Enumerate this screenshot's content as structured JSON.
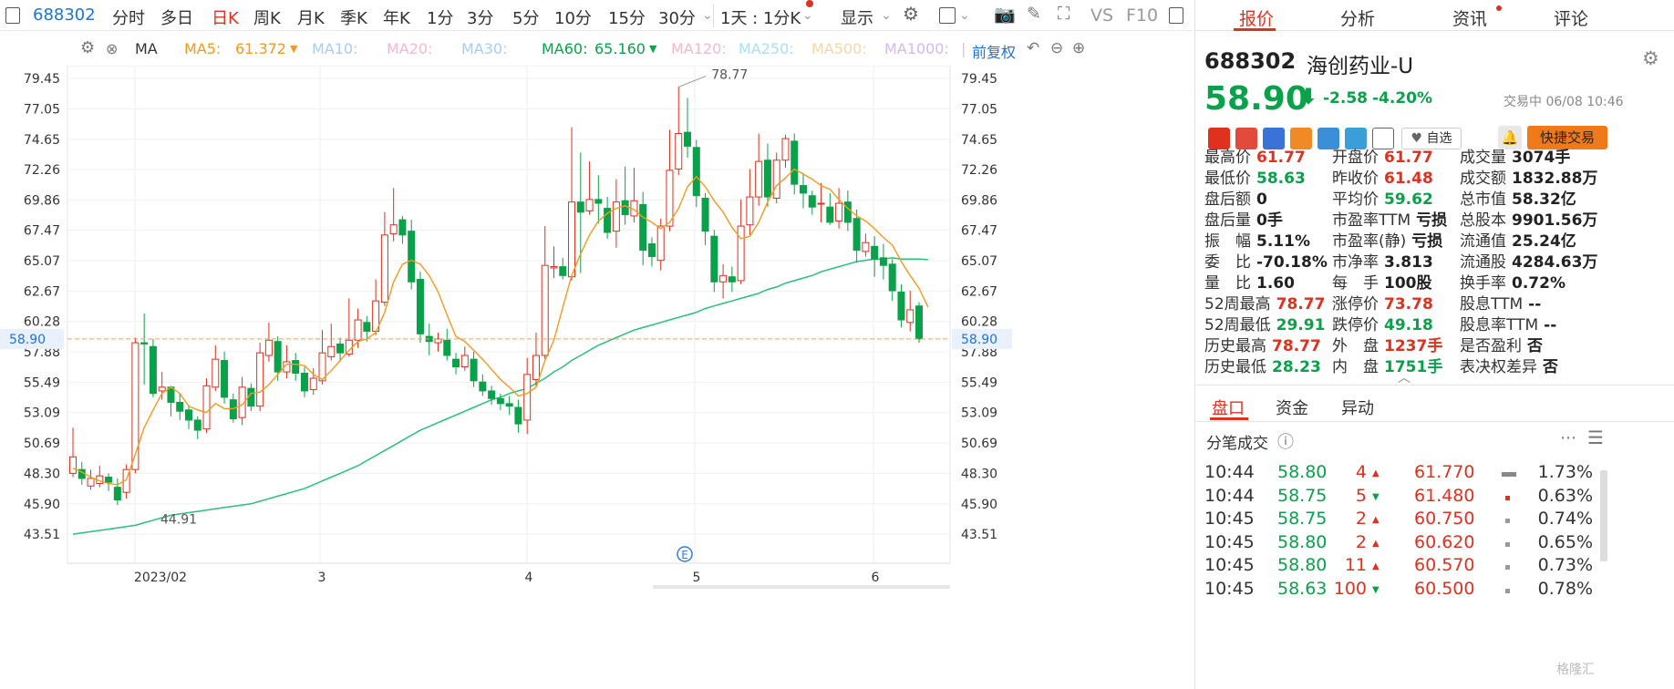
{
  "toolbar": {
    "code": "688302",
    "periods": [
      "分时",
      "多日",
      "日K",
      "周K",
      "月K",
      "季K",
      "年K",
      "1分",
      "3分",
      "5分",
      "10分",
      "15分",
      "30分"
    ],
    "active_period": "日K",
    "range_select": "1天 : 1分K",
    "display_label": "显示",
    "vs_label": "VS",
    "f10_label": "F10"
  },
  "indicators": {
    "type_label": "MA",
    "ma5_label": "MA5:",
    "ma5_value": "61.372",
    "ma10_label": "MA10:",
    "ma20_label": "MA20:",
    "ma30_label": "MA30:",
    "ma60_label": "MA60:",
    "ma60_value": "65.160",
    "ma120_label": "MA120:",
    "ma250_label": "MA250:",
    "ma500_label": "MA500:",
    "ma1000_label": "MA1000:",
    "adjust_label": "前复权"
  },
  "chart_data": {
    "type": "candlestick",
    "y_ticks": [
      "79.45",
      "77.05",
      "74.65",
      "72.26",
      "69.86",
      "67.47",
      "65.07",
      "62.67",
      "60.28",
      "57.88",
      "55.49",
      "53.09",
      "50.69",
      "48.30",
      "45.90",
      "43.51"
    ],
    "ylim": [
      43.51,
      79.45
    ],
    "x_labels": [
      "2023/02",
      "3",
      "4",
      "5",
      "6"
    ],
    "last_price": "58.90",
    "annotations": {
      "high": "78.77",
      "low": "44.91"
    },
    "event_marker": "E",
    "candles": [
      [
        48.3,
        49.6,
        51.9,
        48.0
      ],
      [
        48.6,
        47.9,
        49.2,
        47.4
      ],
      [
        47.3,
        47.9,
        48.6,
        47.0
      ],
      [
        47.5,
        48.1,
        48.9,
        47.2
      ],
      [
        48.0,
        47.6,
        48.3,
        46.9
      ],
      [
        47.2,
        46.2,
        47.9,
        45.8
      ],
      [
        46.8,
        48.6,
        49.0,
        46.3
      ],
      [
        48.6,
        58.6,
        59.0,
        48.3
      ],
      [
        58.6,
        58.5,
        60.9,
        55.3
      ],
      [
        58.3,
        54.6,
        58.9,
        54.3
      ],
      [
        54.8,
        55.1,
        56.3,
        54.1
      ],
      [
        55.1,
        53.9,
        55.2,
        52.8
      ],
      [
        53.9,
        53.2,
        54.6,
        52.5
      ],
      [
        53.3,
        52.5,
        53.7,
        51.8
      ],
      [
        52.5,
        51.7,
        52.8,
        51.0
      ],
      [
        51.8,
        55.2,
        55.8,
        51.5
      ],
      [
        55.1,
        57.3,
        58.4,
        54.8
      ],
      [
        57.2,
        54.3,
        57.9,
        53.8
      ],
      [
        54.1,
        52.6,
        54.6,
        52.3
      ],
      [
        52.7,
        55.1,
        55.9,
        52.1
      ],
      [
        55.0,
        53.6,
        55.4,
        53.2
      ],
      [
        53.6,
        57.8,
        58.6,
        53.2
      ],
      [
        57.6,
        58.8,
        60.2,
        57.1
      ],
      [
        58.7,
        56.3,
        59.1,
        55.6
      ],
      [
        56.3,
        57.1,
        58.4,
        55.8
      ],
      [
        57.2,
        56.2,
        57.8,
        55.6
      ],
      [
        56.2,
        54.8,
        56.7,
        54.3
      ],
      [
        54.9,
        55.8,
        56.6,
        54.5
      ],
      [
        55.6,
        57.8,
        59.6,
        55.3
      ],
      [
        57.5,
        58.3,
        60.1,
        57.2
      ],
      [
        58.5,
        57.8,
        59.0,
        57.1
      ],
      [
        57.7,
        58.8,
        62.1,
        57.5
      ],
      [
        58.8,
        60.4,
        61.3,
        58.2
      ],
      [
        60.2,
        59.5,
        60.7,
        58.7
      ],
      [
        59.5,
        61.9,
        63.6,
        59.2
      ],
      [
        61.8,
        67.1,
        68.9,
        61.5
      ],
      [
        67.2,
        67.9,
        70.8,
        66.6
      ],
      [
        68.3,
        67.1,
        68.6,
        66.4
      ],
      [
        67.4,
        63.4,
        68.3,
        62.8
      ],
      [
        63.6,
        59.3,
        64.2,
        58.6
      ],
      [
        59.1,
        58.7,
        60.1,
        57.6
      ],
      [
        58.6,
        58.9,
        59.4,
        57.9
      ],
      [
        58.8,
        57.6,
        59.7,
        57.2
      ],
      [
        57.3,
        56.7,
        57.8,
        56.1
      ],
      [
        56.7,
        57.6,
        58.3,
        56.4
      ],
      [
        57.3,
        55.6,
        57.9,
        55.1
      ],
      [
        55.5,
        54.8,
        56.1,
        54.4
      ],
      [
        54.8,
        54.2,
        55.2,
        53.7
      ],
      [
        54.2,
        53.8,
        54.6,
        53.3
      ],
      [
        53.8,
        53.6,
        54.4,
        52.9
      ],
      [
        53.5,
        52.2,
        54.1,
        51.5
      ],
      [
        52.5,
        56.1,
        57.4,
        51.4
      ],
      [
        55.7,
        57.6,
        59.4,
        55.1
      ],
      [
        57.6,
        64.7,
        67.8,
        57.3
      ],
      [
        64.5,
        64.6,
        66.2,
        63.7
      ],
      [
        64.6,
        63.9,
        65.3,
        63.6
      ],
      [
        63.8,
        69.7,
        75.6,
        63.5
      ],
      [
        69.7,
        68.9,
        73.6,
        64.1
      ],
      [
        69.0,
        69.9,
        72.9,
        68.7
      ],
      [
        69.9,
        69.6,
        71.8,
        68.0
      ],
      [
        69.2,
        67.3,
        70.1,
        66.8
      ],
      [
        67.4,
        69.7,
        71.5,
        66.1
      ],
      [
        69.8,
        68.7,
        72.5,
        67.9
      ],
      [
        68.6,
        69.8,
        72.4,
        68.1
      ],
      [
        69.5,
        65.9,
        70.5,
        64.7
      ],
      [
        66.4,
        65.4,
        66.9,
        64.6
      ],
      [
        65.1,
        67.8,
        68.4,
        64.3
      ],
      [
        67.8,
        72.2,
        75.4,
        67.4
      ],
      [
        72.3,
        75.1,
        78.8,
        71.8
      ],
      [
        75.2,
        74.1,
        77.9,
        73.2
      ],
      [
        74.0,
        70.2,
        74.6,
        69.3
      ],
      [
        70.0,
        67.4,
        70.4,
        66.3
      ],
      [
        67.0,
        63.4,
        67.5,
        62.6
      ],
      [
        63.4,
        63.9,
        64.8,
        62.1
      ],
      [
        63.8,
        63.4,
        64.6,
        62.6
      ],
      [
        63.5,
        67.8,
        69.9,
        63.2
      ],
      [
        67.9,
        70.1,
        72.3,
        67.1
      ],
      [
        70.1,
        72.9,
        75.1,
        69.4
      ],
      [
        73.0,
        70.1,
        74.3,
        69.3
      ],
      [
        70.0,
        73.0,
        73.6,
        69.6
      ],
      [
        73.0,
        74.7,
        75.0,
        72.4
      ],
      [
        74.5,
        71.1,
        75.1,
        70.3
      ],
      [
        71.0,
        70.4,
        72.0,
        69.2
      ],
      [
        70.2,
        69.3,
        70.6,
        68.7
      ],
      [
        69.6,
        69.6,
        71.2,
        68.1
      ],
      [
        69.3,
        68.1,
        70.4,
        67.9
      ],
      [
        68.2,
        69.6,
        70.8,
        67.6
      ],
      [
        69.7,
        68.1,
        70.6,
        67.4
      ],
      [
        68.4,
        65.9,
        69.1,
        64.9
      ],
      [
        65.8,
        66.5,
        67.2,
        65.4
      ],
      [
        66.2,
        65.2,
        67.0,
        63.8
      ],
      [
        65.3,
        64.7,
        66.4,
        63.6
      ],
      [
        64.8,
        62.7,
        65.2,
        61.9
      ],
      [
        62.6,
        60.4,
        63.2,
        59.8
      ],
      [
        60.2,
        61.2,
        62.7,
        59.5
      ],
      [
        61.5,
        58.9,
        61.8,
        58.6
      ]
    ],
    "ma5": [
      48.7,
      48.4,
      48.0,
      47.7,
      47.5,
      47.4,
      47.8,
      49.8,
      51.9,
      53.3,
      54.6,
      55.1,
      54.6,
      53.6,
      53.3,
      53.1,
      53.8,
      53.4,
      53.4,
      53.7,
      54.6,
      54.7,
      55.3,
      56.1,
      56.9,
      56.9,
      56.8,
      56.1,
      55.7,
      56.4,
      57.2,
      58.0,
      58.7,
      58.9,
      59.4,
      61.0,
      63.4,
      64.8,
      65.1,
      64.8,
      63.9,
      62.6,
      60.8,
      59.1,
      58.7,
      58.0,
      57.3,
      56.5,
      55.7,
      55.1,
      54.4,
      54.6,
      55.1,
      57.2,
      58.8,
      61.4,
      63.9,
      65.6,
      67.1,
      68.2,
      68.8,
      69.2,
      69.4,
      69.1,
      68.5,
      68.1,
      67.6,
      68.1,
      69.2,
      70.9,
      71.7,
      70.9,
      69.8,
      68.9,
      67.7,
      66.8,
      67.0,
      68.1,
      69.7,
      71.0,
      71.6,
      72.3,
      71.9,
      71.5,
      71.0,
      70.7,
      69.9,
      69.2,
      68.6,
      68.2,
      67.6,
      66.9,
      66.3,
      65.0,
      63.9,
      62.9,
      61.4
    ],
    "ma60": [
      43.5,
      43.6,
      43.7,
      43.8,
      43.9,
      44.0,
      44.1,
      44.2,
      44.4,
      44.6,
      44.8,
      45.0,
      45.1,
      45.2,
      45.3,
      45.4,
      45.5,
      45.6,
      45.7,
      45.8,
      45.9,
      46.1,
      46.3,
      46.5,
      46.7,
      46.9,
      47.1,
      47.4,
      47.7,
      48.0,
      48.3,
      48.6,
      48.9,
      49.3,
      49.7,
      50.1,
      50.5,
      50.9,
      51.3,
      51.7,
      52.0,
      52.3,
      52.6,
      52.9,
      53.2,
      53.5,
      53.8,
      54.1,
      54.3,
      54.6,
      54.8,
      55.0,
      55.4,
      55.8,
      56.3,
      56.7,
      57.2,
      57.6,
      58.0,
      58.4,
      58.7,
      59.0,
      59.3,
      59.6,
      59.8,
      60.0,
      60.2,
      60.4,
      60.6,
      60.8,
      61.0,
      61.3,
      61.5,
      61.7,
      61.9,
      62.1,
      62.3,
      62.5,
      62.8,
      63.0,
      63.3,
      63.5,
      63.7,
      63.9,
      64.2,
      64.4,
      64.6,
      64.8,
      65.0,
      65.1,
      65.2,
      65.2,
      65.3,
      65.2,
      65.2,
      65.2,
      65.16
    ]
  },
  "right_panel": {
    "tabs": [
      "报价",
      "分析",
      "资讯",
      "评论"
    ],
    "code": "688302",
    "name": "海创药业-U",
    "price": "58.90",
    "change": "-2.58",
    "change_pct": "-4.20%",
    "status": "交易中 06/08 10:46",
    "watch_label": "自选",
    "trade_label": "快捷交易",
    "stats": [
      [
        "最高价",
        "61.77"
      ],
      [
        "开盘价",
        "61.77"
      ],
      [
        "成交量",
        "3074手"
      ],
      [
        "最低价",
        "58.63"
      ],
      [
        "昨收价",
        "61.48"
      ],
      [
        "成交额",
        "1832.88万"
      ],
      [
        "盘后额",
        "0"
      ],
      [
        "平均价",
        "59.62"
      ],
      [
        "总市值",
        "58.32亿"
      ],
      [
        "盘后量",
        "0手"
      ],
      [
        "市盈率TTM",
        "亏损"
      ],
      [
        "总股本",
        "9901.56万"
      ],
      [
        "振　幅",
        "5.11%"
      ],
      [
        "市盈率(静)",
        "亏损"
      ],
      [
        "流通值",
        "25.24亿"
      ],
      [
        "委　比",
        "-70.18%"
      ],
      [
        "市净率",
        "3.813"
      ],
      [
        "流通股",
        "4284.63万"
      ],
      [
        "量　比",
        "1.60"
      ],
      [
        "每　手",
        "100股"
      ],
      [
        "换手率",
        "0.72%"
      ],
      [
        "52周最高",
        "78.77"
      ],
      [
        "涨停价",
        "73.78"
      ],
      [
        "股息TTM",
        "--"
      ],
      [
        "52周最低",
        "29.91"
      ],
      [
        "跌停价",
        "49.18"
      ],
      [
        "股息率TTM",
        "--"
      ],
      [
        "历史最高",
        "78.77"
      ],
      [
        "外　盘",
        "1237手"
      ],
      [
        "是否盈利",
        "否"
      ],
      [
        "历史最低",
        "28.23"
      ],
      [
        "内　盘",
        "1751手"
      ],
      [
        "表决权差异",
        "否"
      ]
    ],
    "sub_tabs": [
      "盘口",
      "资金",
      "异动"
    ],
    "ticks_title": "分笔成交",
    "ticks": [
      {
        "time": "10:44",
        "price": "58.80",
        "vol": "4",
        "dir": "up",
        "ref": "61.770",
        "pct": "1.73%"
      },
      {
        "time": "10:44",
        "price": "58.75",
        "vol": "5",
        "dir": "down",
        "ref": "61.480",
        "pct": "0.63%"
      },
      {
        "time": "10:45",
        "price": "58.75",
        "vol": "2",
        "dir": "up",
        "ref": "60.750",
        "pct": "0.74%"
      },
      {
        "time": "10:45",
        "price": "58.80",
        "vol": "2",
        "dir": "up",
        "ref": "60.620",
        "pct": "0.65%"
      },
      {
        "time": "10:45",
        "price": "58.80",
        "vol": "11",
        "dir": "up",
        "ref": "60.570",
        "pct": "0.73%"
      },
      {
        "time": "10:45",
        "price": "58.63",
        "vol": "100",
        "dir": "down",
        "ref": "60.500",
        "pct": "0.78%"
      }
    ],
    "watermark": "格隆汇"
  },
  "colors": {
    "up": "#e0301e",
    "down": "#0aa14b",
    "ma5": "#f39a1e",
    "ma60": "#29c07a",
    "accent": "#1e73d8"
  }
}
